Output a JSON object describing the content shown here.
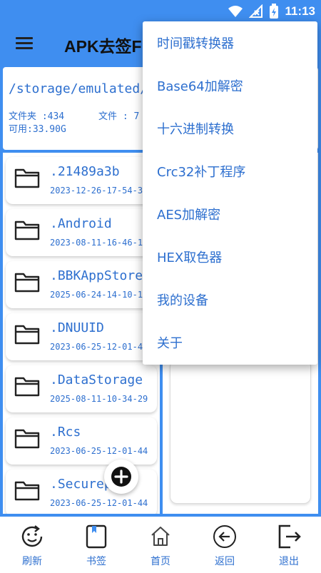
{
  "status_bar": {
    "time": "11:13",
    "icons": [
      "wifi-icon",
      "signal-off-icon",
      "battery-charging-icon"
    ]
  },
  "app_bar": {
    "title": "APK去签F",
    "menu_icon": "hamburger-menu-icon"
  },
  "path_panel": {
    "path": "/storage/emulated/",
    "folders_label": "文件夹 :434",
    "files_label": "文件 : 7",
    "available_label": "可用:33.90G"
  },
  "files": [
    {
      "name": ".21489a3b",
      "date": "2023-12-26-17-54-3"
    },
    {
      "name": ".Android",
      "date": "2023-08-11-16-46-1"
    },
    {
      "name": ".BBKAppStore",
      "date": "2025-06-24-14-10-1"
    },
    {
      "name": ".DNUUID",
      "date": "2023-06-25-12-01-4"
    },
    {
      "name": ".DataStorage",
      "date": "2025-08-11-10-34-29"
    },
    {
      "name": ".Rcs",
      "date": "2023-06-25-12-01-44"
    },
    {
      "name": ".Securep",
      "date": "2023-06-25-12-01-44"
    }
  ],
  "fab": {
    "icon": "add-circle-icon"
  },
  "bottom_nav": [
    {
      "label": "刷新",
      "icon": "refresh-face-icon"
    },
    {
      "label": "书签",
      "icon": "bookmark-icon"
    },
    {
      "label": "首页",
      "icon": "home-icon"
    },
    {
      "label": "返回",
      "icon": "back-arrow-icon"
    },
    {
      "label": "退出",
      "icon": "exit-icon"
    }
  ],
  "dropdown_menu": [
    "时间戳转换器",
    "Base64加解密",
    "十六进制转换",
    "Crc32补丁程序",
    "AES加解密",
    "HEX取色器",
    "我的设备",
    "关于"
  ],
  "colors": {
    "primary": "#3f8ef0",
    "text_blue": "#2d6fcf",
    "surface": "#ffffff"
  }
}
